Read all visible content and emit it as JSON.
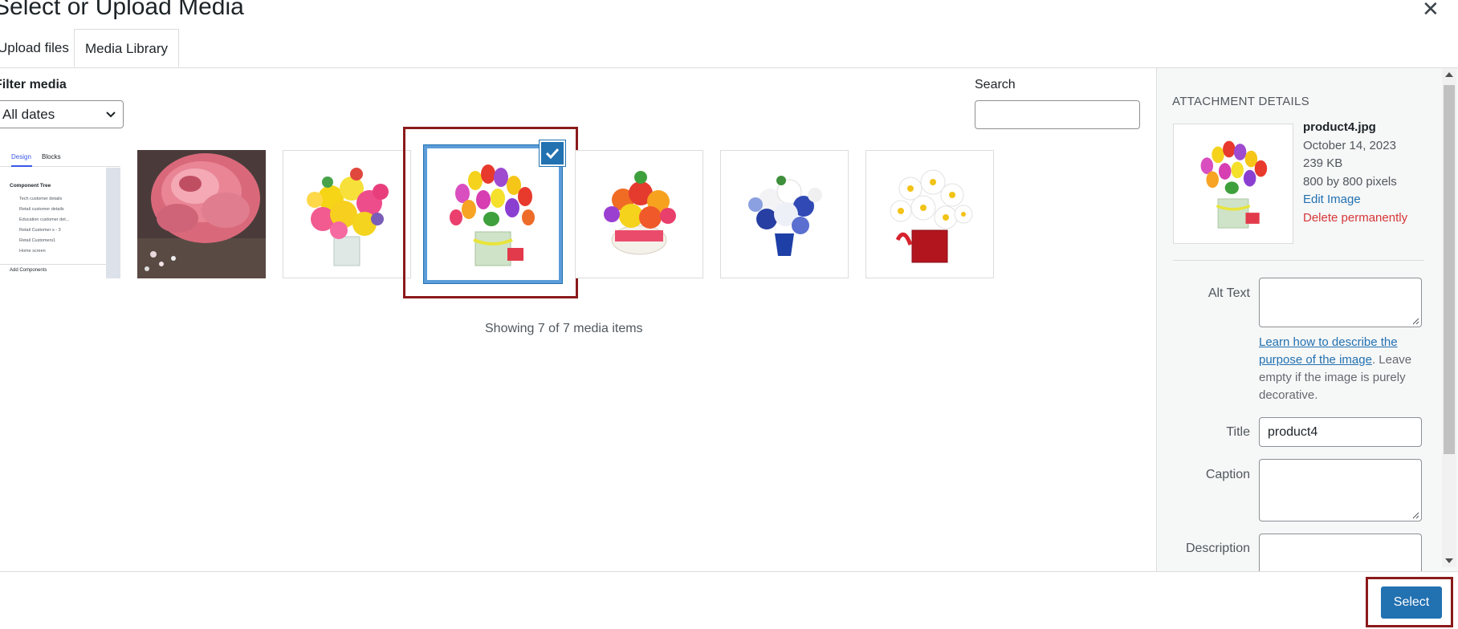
{
  "modal": {
    "title": "Select or Upload Media",
    "close_glyph": "✕"
  },
  "tabs": [
    {
      "label": "Upload files",
      "active": false
    },
    {
      "label": "Media Library",
      "active": true
    }
  ],
  "toolbar": {
    "filter_label": "Filter media",
    "date_filter_value": "All dates",
    "search_label": "Search",
    "search_value": ""
  },
  "screenshot_thumb": {
    "tab_design": "Design",
    "tab_blocks": "Blocks",
    "heading": "Component Tree",
    "items": [
      "Tech customer details",
      "Retail customer details",
      "Education customer det...",
      "Retail Customer s - 3",
      "Retail Customers1",
      "Home screen"
    ],
    "footer": "Add Components"
  },
  "media_items": [
    {
      "name": "app-screenshot",
      "selected": false
    },
    {
      "name": "pink-peony",
      "selected": false
    },
    {
      "name": "yellow-pink-bouquet",
      "selected": false
    },
    {
      "name": "product4-tulips",
      "selected": true
    },
    {
      "name": "orange-bouquet-cake",
      "selected": false
    },
    {
      "name": "blue-white-bouquet",
      "selected": false
    },
    {
      "name": "white-daisies-red-vase",
      "selected": false
    }
  ],
  "count_text": "Showing 7 of 7 media items",
  "attachment": {
    "heading": "Attachment Details",
    "filename": "product4.jpg",
    "date": "October 14, 2023",
    "size": "239 KB",
    "dimensions": "800 by 800 pixels",
    "edit_link": "Edit Image",
    "delete_link": "Delete permanently",
    "alt_label": "Alt Text",
    "alt_value": "",
    "help_link": "Learn how to describe the purpose of the image",
    "help_rest": ". Leave empty if the image is purely decorative.",
    "title_label": "Title",
    "title_value": "product4",
    "caption_label": "Caption",
    "caption_value": "",
    "description_label": "Description",
    "description_value": ""
  },
  "footer": {
    "select_label": "Select"
  },
  "colors": {
    "primary": "#2271b1",
    "danger": "#d63638",
    "highlight_box": "#8b1a1a",
    "sidebar_bg": "#f6f7f7"
  }
}
